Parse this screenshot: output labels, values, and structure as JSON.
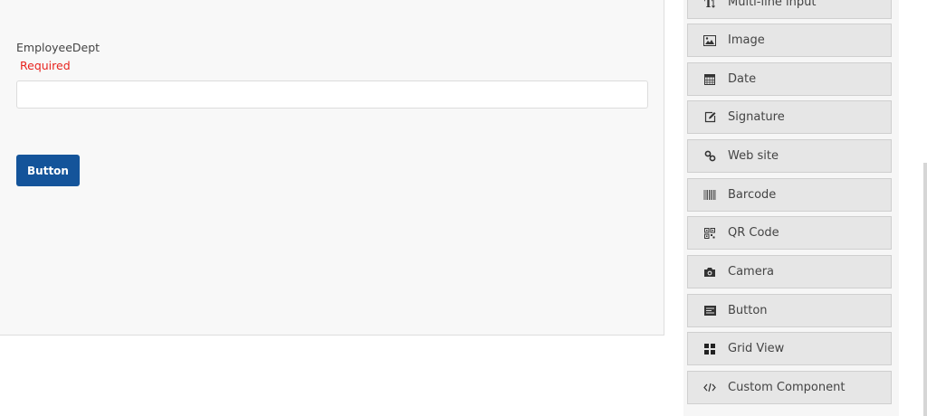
{
  "form": {
    "field_label": "EmployeeDept",
    "required_text": "Required",
    "input_value": "",
    "button_label": "Button"
  },
  "toolbox": {
    "items": [
      {
        "label": "Multi-line input",
        "icon": "text-height-icon"
      },
      {
        "label": "Image",
        "icon": "image-icon"
      },
      {
        "label": "Date",
        "icon": "calendar-icon"
      },
      {
        "label": "Signature",
        "icon": "edit-icon"
      },
      {
        "label": "Web site",
        "icon": "link-icon"
      },
      {
        "label": "Barcode",
        "icon": "barcode-icon"
      },
      {
        "label": "QR Code",
        "icon": "qrcode-icon"
      },
      {
        "label": "Camera",
        "icon": "camera-icon"
      },
      {
        "label": "Button",
        "icon": "button-icon"
      },
      {
        "label": "Grid View",
        "icon": "grid-icon"
      },
      {
        "label": "Custom Component",
        "icon": "code-icon"
      }
    ]
  },
  "colors": {
    "primary": "#14549a",
    "required": "#e8231e",
    "tool_bg": "#e6e6e6"
  }
}
